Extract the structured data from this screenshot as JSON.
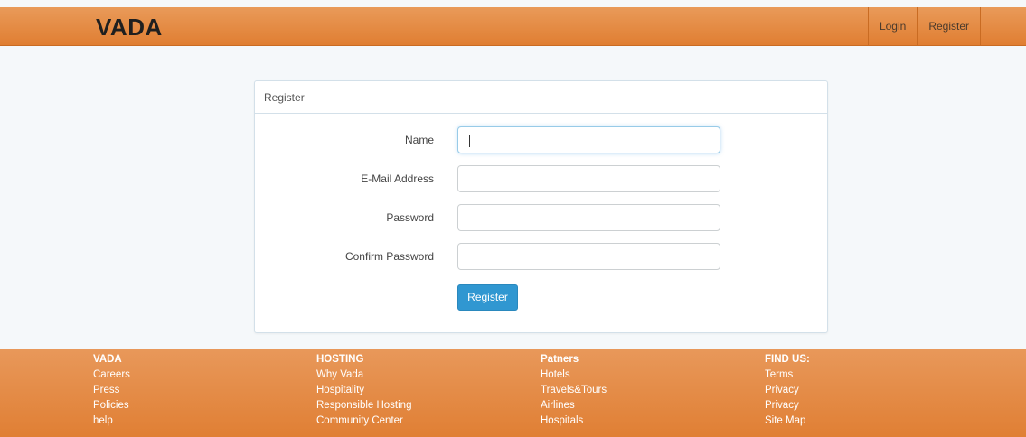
{
  "navbar": {
    "brand": "VADA",
    "links": [
      {
        "label": "Login"
      },
      {
        "label": "Register"
      }
    ]
  },
  "panel": {
    "heading": "Register",
    "fields": [
      {
        "label": "Name",
        "value": ""
      },
      {
        "label": "E-Mail Address",
        "value": ""
      },
      {
        "label": "Password",
        "value": ""
      },
      {
        "label": "Confirm Password",
        "value": ""
      }
    ],
    "submit_label": "Register"
  },
  "footer": {
    "columns": [
      {
        "heading": "VADA",
        "items": [
          "Careers",
          "Press",
          "Policies",
          "help"
        ]
      },
      {
        "heading": "HOSTING",
        "items": [
          "Why Vada",
          "Hospitality",
          "Responsible Hosting",
          "Community Center"
        ]
      },
      {
        "heading": "Patners",
        "items": [
          "Hotels",
          "Travels&Tours",
          "Airlines",
          "Hospitals"
        ]
      },
      {
        "heading": "FIND US:",
        "items": [
          "Terms",
          "Privacy",
          "Privacy",
          "Site Map"
        ]
      }
    ]
  },
  "colors": {
    "navbar": "#e28a45",
    "footer": "#e3873e",
    "page_background": "#f5f8fa",
    "primary_button": "#3097d1"
  }
}
